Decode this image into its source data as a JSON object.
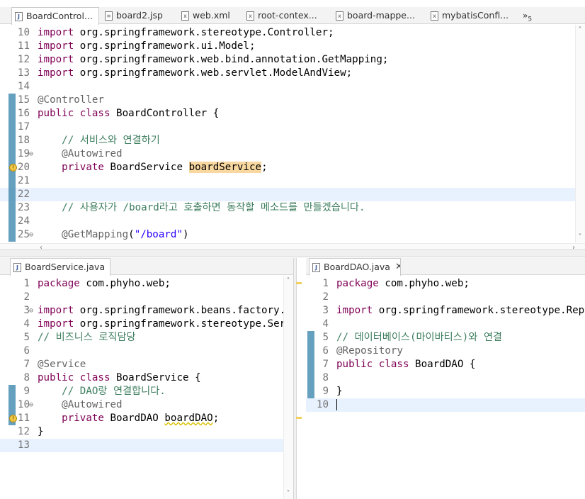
{
  "top_editor": {
    "tabs": [
      {
        "label": "BoardControl...",
        "icon": "java-file-icon",
        "active": true,
        "closable": true
      },
      {
        "label": "board2.jsp",
        "icon": "jsp-file-icon"
      },
      {
        "label": "web.xml",
        "icon": "xml-file-icon"
      },
      {
        "label": "root-contex...",
        "icon": "xml-file-icon"
      },
      {
        "label": "board-mappe...",
        "icon": "xml-file-icon"
      },
      {
        "label": "mybatisConfi...",
        "icon": "xml-file-icon"
      }
    ],
    "overflow": "»",
    "overflow_count": "5",
    "lines": [
      {
        "n": "10",
        "tokens": [
          [
            "kw",
            "import"
          ],
          [
            "",
            " org.springframework.stereotype.Controller;"
          ]
        ]
      },
      {
        "n": "11",
        "tokens": [
          [
            "kw",
            "import"
          ],
          [
            "",
            " org.springframework.ui.Model;"
          ]
        ]
      },
      {
        "n": "12",
        "tokens": [
          [
            "kw",
            "import"
          ],
          [
            "",
            " org.springframework.web.bind.annotation.GetMapping;"
          ]
        ]
      },
      {
        "n": "13",
        "tokens": [
          [
            "kw",
            "import"
          ],
          [
            "",
            " org.springframework.web.servlet.ModelAndView;"
          ]
        ]
      },
      {
        "n": "14",
        "tokens": []
      },
      {
        "n": "15",
        "tokens": [
          [
            "ann",
            "@Controller"
          ]
        ]
      },
      {
        "n": "16",
        "tokens": [
          [
            "kw",
            "public"
          ],
          [
            "",
            " "
          ],
          [
            "kw",
            "class"
          ],
          [
            "",
            " BoardController {"
          ]
        ]
      },
      {
        "n": "17",
        "tokens": []
      },
      {
        "n": "18",
        "tokens": [
          [
            "",
            "    "
          ],
          [
            "cmt",
            "// 서비스와 연결하기"
          ]
        ]
      },
      {
        "n": "19",
        "fold": true,
        "tokens": [
          [
            "",
            "    "
          ],
          [
            "ann",
            "@Autowired"
          ]
        ]
      },
      {
        "n": "20",
        "warn": true,
        "tokens": [
          [
            "",
            "    "
          ],
          [
            "kw",
            "private"
          ],
          [
            "",
            " BoardService "
          ],
          [
            "occ",
            "boardService"
          ],
          [
            "",
            ";"
          ]
        ]
      },
      {
        "n": "21",
        "tokens": []
      },
      {
        "n": "22",
        "hl": true,
        "tokens": []
      },
      {
        "n": "23",
        "tokens": [
          [
            "",
            "    "
          ],
          [
            "cmt",
            "// 사용자가 /board라고 호출하면 동작할 메소드를 만들겠습니다."
          ]
        ]
      },
      {
        "n": "24",
        "tokens": []
      },
      {
        "n": "25",
        "fold": true,
        "tokens": [
          [
            "",
            "    "
          ],
          [
            "ann",
            "@GetMapping"
          ],
          [
            "",
            "("
          ],
          [
            "str",
            "\"/board\""
          ],
          [
            "",
            ")"
          ]
        ]
      }
    ]
  },
  "service_editor": {
    "tab": {
      "label": "BoardService.java",
      "icon": "java-file-icon",
      "closable": true
    },
    "lines": [
      {
        "n": "1",
        "tokens": [
          [
            "kw",
            "package"
          ],
          [
            "",
            " com.phyho.web;"
          ]
        ]
      },
      {
        "n": "2",
        "tokens": []
      },
      {
        "n": "3",
        "fold": true,
        "tokens": [
          [
            "kw",
            "import"
          ],
          [
            "",
            " org.springframework.beans.factory.an"
          ]
        ]
      },
      {
        "n": "4",
        "tokens": [
          [
            "kw",
            "import"
          ],
          [
            "",
            " org.springframework.stereotype.Servi"
          ]
        ]
      },
      {
        "n": "5",
        "tokens": [
          [
            "cmt",
            "// 비즈니스 로직담당"
          ]
        ]
      },
      {
        "n": "6",
        "tokens": []
      },
      {
        "n": "7",
        "tokens": [
          [
            "ann",
            "@Service"
          ]
        ]
      },
      {
        "n": "8",
        "tokens": [
          [
            "kw",
            "public"
          ],
          [
            "",
            " "
          ],
          [
            "kw",
            "class"
          ],
          [
            "",
            " BoardService {"
          ]
        ]
      },
      {
        "n": "9",
        "tokens": [
          [
            "",
            "    "
          ],
          [
            "cmt",
            "// DAO랑 연결합니다."
          ]
        ]
      },
      {
        "n": "10",
        "fold": true,
        "tokens": [
          [
            "",
            "    "
          ],
          [
            "ann",
            "@Autowired"
          ]
        ]
      },
      {
        "n": "11",
        "warn": true,
        "tokens": [
          [
            "",
            "    "
          ],
          [
            "kw",
            "private"
          ],
          [
            "",
            " BoardDAO "
          ],
          [
            "squig",
            "boardDAO"
          ],
          [
            "",
            ";"
          ]
        ]
      },
      {
        "n": "12",
        "tokens": [
          [
            "",
            "}"
          ]
        ]
      },
      {
        "n": "13",
        "hl": true,
        "tokens": []
      }
    ]
  },
  "dao_editor": {
    "tab": {
      "label": "BoardDAO.java",
      "icon": "java-file-icon",
      "closable": true
    },
    "lines": [
      {
        "n": "1",
        "tokens": [
          [
            "kw",
            "package"
          ],
          [
            "",
            " com.phyho.web;"
          ]
        ]
      },
      {
        "n": "2",
        "tokens": []
      },
      {
        "n": "3",
        "tokens": [
          [
            "kw",
            "import"
          ],
          [
            "",
            " org.springframework.stereotype.Repos"
          ]
        ]
      },
      {
        "n": "4",
        "tokens": []
      },
      {
        "n": "5",
        "tokens": [
          [
            "cmt",
            "// 데이터베이스(마이바티스)와 연결"
          ]
        ]
      },
      {
        "n": "6",
        "tokens": [
          [
            "ann",
            "@Repository"
          ]
        ]
      },
      {
        "n": "7",
        "tokens": [
          [
            "kw",
            "public"
          ],
          [
            "",
            " "
          ],
          [
            "kw",
            "class"
          ],
          [
            "",
            " BoardDAO {"
          ]
        ]
      },
      {
        "n": "8",
        "tokens": []
      },
      {
        "n": "9",
        "tokens": [
          [
            "",
            "}"
          ]
        ]
      },
      {
        "n": "10",
        "hl": true,
        "cursor": true,
        "tokens": []
      }
    ]
  }
}
